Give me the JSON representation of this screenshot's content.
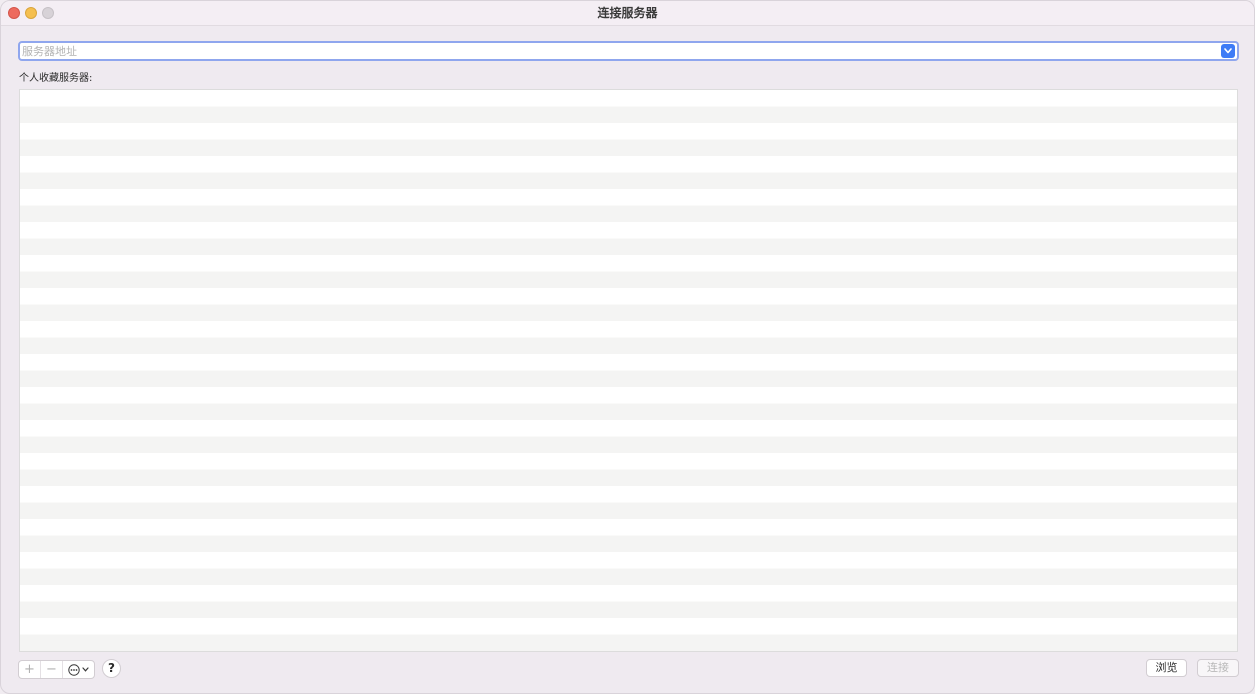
{
  "window": {
    "title": "连接服务器"
  },
  "address": {
    "placeholder": "服务器地址",
    "value": ""
  },
  "favorites": {
    "label": "个人收藏服务器:",
    "items": []
  },
  "toolbar": {
    "add_label": "+",
    "remove_label": "−",
    "more_icon": "ellipsis-circle-icon",
    "help_label": "?"
  },
  "buttons": {
    "browse_label": "浏览",
    "connect_label": "连接"
  },
  "colors": {
    "accent": "#3e7bf6",
    "focus_ring": "#8fa6ee",
    "close": "#ed6a5e",
    "minimize": "#f5bf4f"
  }
}
